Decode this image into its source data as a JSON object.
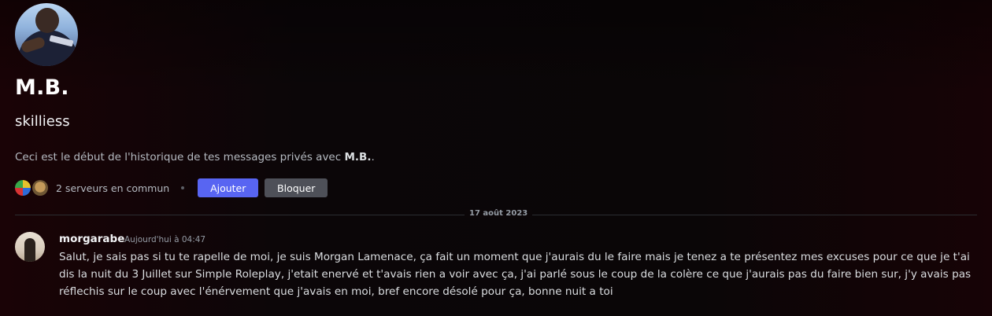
{
  "profile": {
    "display_name": "M.B.",
    "username": "skilliess",
    "avatar_icon": "user-avatar"
  },
  "intro": {
    "text_before": "Ceci est le début de l'historique de tes messages privés avec ",
    "name": "M.B.",
    "text_after": "."
  },
  "mutual": {
    "text": "2 serveurs en commun",
    "server_icons": [
      "server-icon-1",
      "server-icon-2"
    ]
  },
  "actions": {
    "add_label": "Ajouter",
    "block_label": "Bloquer"
  },
  "divider": {
    "date": "17 août 2023"
  },
  "messages": [
    {
      "author": "morgarabe",
      "timestamp": "Aujourd'hui à 04:47",
      "content": "Salut, je sais pas si tu te rapelle de moi, je suis Morgan Lamenace, ça fait un moment que j'aurais du le faire mais je tenez a te présentez mes excuses pour ce que je t'ai dis la nuit du 3 Juillet sur Simple Roleplay, j'etait enervé et t'avais rien a voir avec ça, j'ai parlé sous le coup de la colère ce que j'aurais pas du faire bien sur, j'y avais pas réflechis sur le coup avec l'énérvement que j'avais en moi, bref encore désolé pour ça, bonne nuit a toi"
    }
  ],
  "colors": {
    "accent": "#5865f2",
    "secondary_button": "#4e5058"
  }
}
